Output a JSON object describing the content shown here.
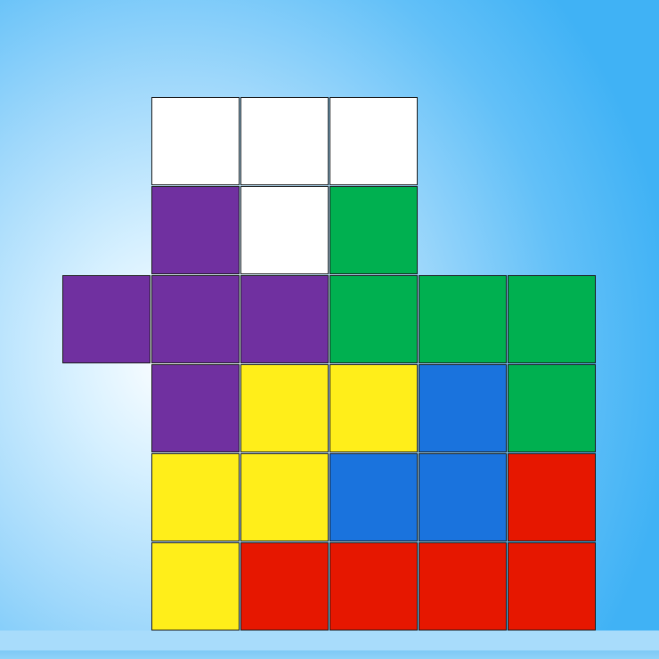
{
  "board": {
    "rows": 6,
    "cols": 6,
    "cells": [
      [
        null,
        "white",
        "white",
        "white",
        null,
        null
      ],
      [
        null,
        "purple",
        "white",
        "green",
        null,
        null
      ],
      [
        "purple",
        "purple",
        "purple",
        "green",
        "green",
        "green"
      ],
      [
        null,
        "purple",
        "yellow",
        "yellow",
        "blue",
        "green"
      ],
      [
        null,
        "yellow",
        "yellow",
        "blue",
        "blue",
        "red"
      ],
      [
        null,
        "yellow",
        "red",
        "red",
        "red",
        "red"
      ]
    ]
  },
  "colors": {
    "white": "#ffffff",
    "purple": "#7030a0",
    "green": "#00b050",
    "yellow": "#ffee1a",
    "blue": "#1a73dd",
    "red": "#e61700",
    "grid_line": "#1a1a1a"
  }
}
